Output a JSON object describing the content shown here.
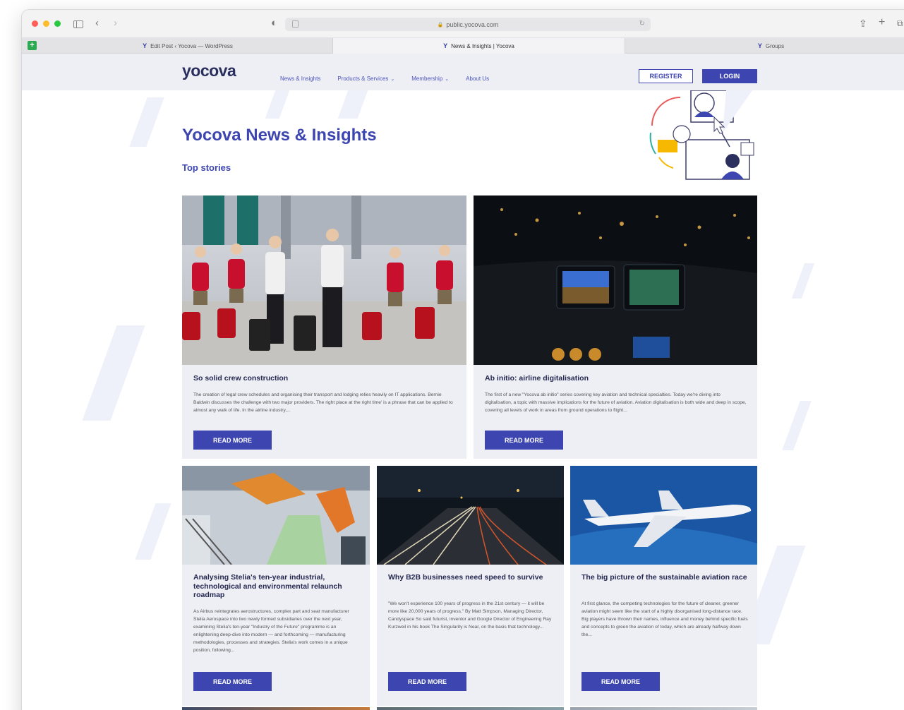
{
  "browser": {
    "url": "public.yocova.com",
    "tabs": [
      {
        "favicon": "Y",
        "title": "Edit Post ‹ Yocova — WordPress"
      },
      {
        "favicon": "Y",
        "title": "News & Insights | Yocova"
      },
      {
        "favicon": "Y",
        "title": "Groups"
      }
    ]
  },
  "header": {
    "logo": "yocova",
    "nav": [
      {
        "label": "News & Insights"
      },
      {
        "label": "Products & Services"
      },
      {
        "label": "Membership"
      },
      {
        "label": "About Us"
      }
    ],
    "register_label": "REGISTER",
    "login_label": "LOGIN"
  },
  "page": {
    "title": "Yocova News & Insights",
    "section_title": "Top stories"
  },
  "cards": [
    {
      "title": "So solid crew construction",
      "excerpt": "The creation of legal crew schedules and organising their transport and lodging relies heavily on IT applications. Bernie Baldwin discusses the challenge with two major providers. The right place at the right time' is a phrase that can be applied to almost any walk of life. In the airline industry,...",
      "button": "READ MORE"
    },
    {
      "title": "Ab initio: airline digitalisation",
      "excerpt": "The first of a new \"Yocova ab initio\" series covering key aviation and technical specialties. Today we're diving into digitalisation, a topic with massive implications for the future of aviation. Aviation digitalisation is both wide and deep in scope, covering all levels of work in areas from ground operations to flight...",
      "button": "READ MORE"
    },
    {
      "title": "Analysing Stelia's ten-year industrial, technological and environmental relaunch roadmap",
      "excerpt": "As Airbus reintegrates aerostructures, complex part and seat manufacturer Stelia Aerospace into two newly formed subsidiaries over the next year, examining Stelia's ten-year \"Industry of the Future\" programme is an enlightening deep-dive into modern — and forthcoming — manufacturing methodologies, processes and strategies. Stelia's work comes in a unique position, following...",
      "button": "READ MORE"
    },
    {
      "title": "Why B2B businesses need speed to survive",
      "excerpt": "\"We won't experience 100 years of progress in the 21st century — it will be more like 20,000 years of progress.\" By Matt Simpson, Managing Director, Candyspace So said futurist, inventor and Google Director of Engineering Ray Kurzweil in his book The Singularity is Near, on the basis that technology...",
      "button": "READ MORE"
    },
    {
      "title": "The big picture of the sustainable aviation race",
      "excerpt": "At first glance, the competing technologies for the future of cleaner, greener aviation might seem like the start of a highly disorganised long-distance race. Big players have thrown their names, influence and money behind specific fuels and concepts to green the aviation of today, which are already halfway down the...",
      "button": "READ MORE"
    }
  ],
  "colors": {
    "brand_blue": "#3d46b0",
    "logo_navy": "#2b2f5e",
    "card_bg": "#eeeff5"
  }
}
